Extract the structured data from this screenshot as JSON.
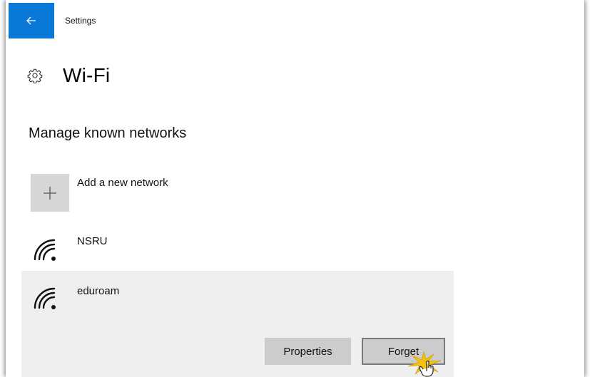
{
  "window": {
    "title": "Settings"
  },
  "header": {
    "title": "Wi-Fi"
  },
  "section": {
    "title": "Manage known networks"
  },
  "add_network": {
    "label": "Add a new network"
  },
  "networks": [
    {
      "name": "NSRU"
    },
    {
      "name": "eduroam"
    }
  ],
  "buttons": {
    "properties": "Properties",
    "forget": "Forget"
  },
  "colors": {
    "accent": "#0a78d7",
    "selected_row": "#efefef",
    "button_bg": "#cccccc"
  }
}
